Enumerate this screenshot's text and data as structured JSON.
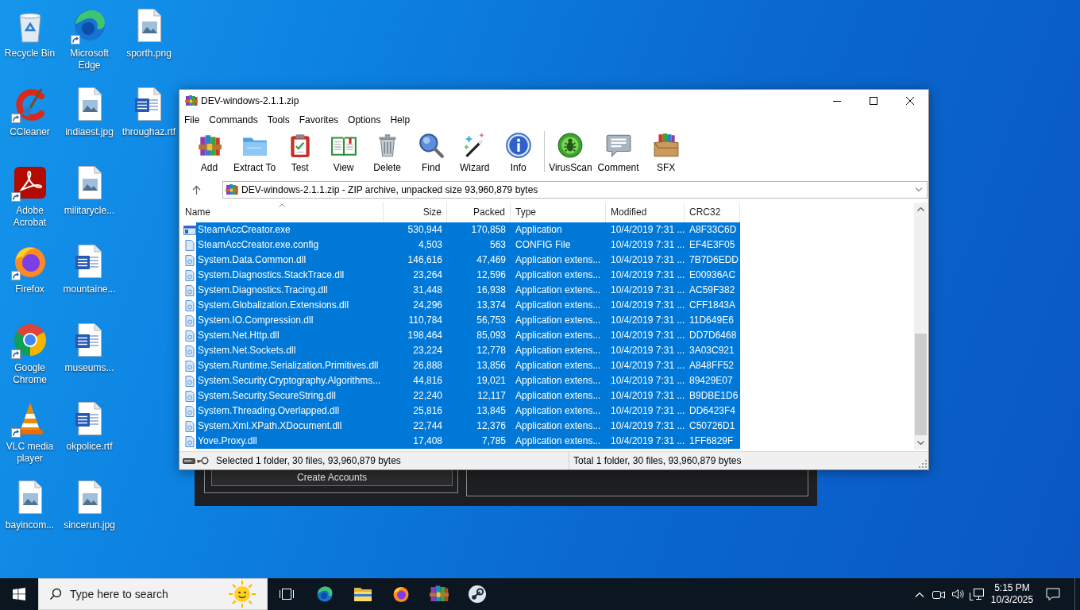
{
  "desktop": {
    "icons": [
      {
        "label": "Recycle Bin",
        "kind": "recycle-bin",
        "shortcut": false
      },
      {
        "label": "CCleaner",
        "kind": "ccleaner",
        "shortcut": true
      },
      {
        "label": "Adobe Acrobat",
        "kind": "acrobat",
        "shortcut": true
      },
      {
        "label": "Firefox",
        "kind": "firefox",
        "shortcut": true
      },
      {
        "label": "Google Chrome",
        "kind": "chrome",
        "shortcut": true
      },
      {
        "label": "VLC media player",
        "kind": "vlc",
        "shortcut": true
      },
      {
        "label": "bayincom...",
        "kind": "image",
        "shortcut": false
      },
      {
        "label": "Microsoft Edge",
        "kind": "edge",
        "shortcut": true
      },
      {
        "label": "indiaest.jpg",
        "kind": "image",
        "shortcut": false
      },
      {
        "label": "militarycle...",
        "kind": "image",
        "shortcut": false
      },
      {
        "label": "mountaine...",
        "kind": "word",
        "shortcut": false
      },
      {
        "label": "museums...",
        "kind": "word",
        "shortcut": false
      },
      {
        "label": "okpolice.rtf",
        "kind": "word",
        "shortcut": false
      },
      {
        "label": "sincerun.jpg",
        "kind": "image",
        "shortcut": false
      },
      {
        "label": "sporth.png",
        "kind": "image",
        "shortcut": false
      },
      {
        "label": "throughaz.rtf",
        "kind": "word",
        "shortcut": false
      }
    ]
  },
  "background_window": {
    "button": "Create Accounts"
  },
  "window": {
    "title": "DEV-windows-2.1.1.zip",
    "menu": [
      "File",
      "Commands",
      "Tools",
      "Favorites",
      "Options",
      "Help"
    ],
    "toolbar_groups": [
      {
        "buttons": [
          {
            "label": "Add",
            "kind": "add"
          },
          {
            "label": "Extract To",
            "kind": "extract"
          },
          {
            "label": "Test",
            "kind": "test"
          },
          {
            "label": "View",
            "kind": "view"
          },
          {
            "label": "Delete",
            "kind": "delete"
          },
          {
            "label": "Find",
            "kind": "find"
          },
          {
            "label": "Wizard",
            "kind": "wizard"
          },
          {
            "label": "Info",
            "kind": "info"
          }
        ]
      },
      {
        "buttons": [
          {
            "label": "VirusScan",
            "kind": "virusscan"
          },
          {
            "label": "Comment",
            "kind": "comment"
          },
          {
            "label": "SFX",
            "kind": "sfx"
          }
        ]
      }
    ],
    "address": "DEV-windows-2.1.1.zip - ZIP archive, unpacked size 93,960,879 bytes",
    "table": {
      "columns": [
        {
          "label": "Name",
          "sorted": true
        },
        {
          "label": "Size",
          "sorted": false
        },
        {
          "label": "Packed",
          "sorted": false
        },
        {
          "label": "Type",
          "sorted": false
        },
        {
          "label": "Modified",
          "sorted": false
        },
        {
          "label": "CRC32",
          "sorted": false
        }
      ],
      "rows": [
        {
          "kind": "exe",
          "name": "SteamAccCreator.exe",
          "size": "530,944",
          "packed": "170,858",
          "type": "Application",
          "modified": "10/4/2019 7:31 ...",
          "crc32": "A8F33C6D",
          "selected": true
        },
        {
          "kind": "config",
          "name": "SteamAccCreator.exe.config",
          "size": "4,503",
          "packed": "563",
          "type": "CONFIG File",
          "modified": "10/4/2019 7:31 ...",
          "crc32": "EF4E3F05",
          "selected": true
        },
        {
          "kind": "dll",
          "name": "System.Data.Common.dll",
          "size": "146,616",
          "packed": "47,469",
          "type": "Application extens...",
          "modified": "10/4/2019 7:31 ...",
          "crc32": "7B7D6EDD",
          "selected": true
        },
        {
          "kind": "dll",
          "name": "System.Diagnostics.StackTrace.dll",
          "size": "23,264",
          "packed": "12,596",
          "type": "Application extens...",
          "modified": "10/4/2019 7:31 ...",
          "crc32": "E00936AC",
          "selected": true
        },
        {
          "kind": "dll",
          "name": "System.Diagnostics.Tracing.dll",
          "size": "31,448",
          "packed": "16,938",
          "type": "Application extens...",
          "modified": "10/4/2019 7:31 ...",
          "crc32": "AC59F382",
          "selected": true
        },
        {
          "kind": "dll",
          "name": "System.Globalization.Extensions.dll",
          "size": "24,296",
          "packed": "13,374",
          "type": "Application extens...",
          "modified": "10/4/2019 7:31 ...",
          "crc32": "CFF1843A",
          "selected": true
        },
        {
          "kind": "dll",
          "name": "System.IO.Compression.dll",
          "size": "110,784",
          "packed": "56,753",
          "type": "Application extens...",
          "modified": "10/4/2019 7:31 ...",
          "crc32": "11D649E6",
          "selected": true
        },
        {
          "kind": "dll",
          "name": "System.Net.Http.dll",
          "size": "198,464",
          "packed": "85,093",
          "type": "Application extens...",
          "modified": "10/4/2019 7:31 ...",
          "crc32": "DD7D6468",
          "selected": true
        },
        {
          "kind": "dll",
          "name": "System.Net.Sockets.dll",
          "size": "23,224",
          "packed": "12,778",
          "type": "Application extens...",
          "modified": "10/4/2019 7:31 ...",
          "crc32": "3A03C921",
          "selected": true
        },
        {
          "kind": "dll",
          "name": "System.Runtime.Serialization.Primitives.dll",
          "size": "26,888",
          "packed": "13,856",
          "type": "Application extens...",
          "modified": "10/4/2019 7:31 ...",
          "crc32": "A848FF52",
          "selected": true
        },
        {
          "kind": "dll",
          "name": "System.Security.Cryptography.Algorithms...",
          "size": "44,816",
          "packed": "19,021",
          "type": "Application extens...",
          "modified": "10/4/2019 7:31 ...",
          "crc32": "89429E07",
          "selected": true
        },
        {
          "kind": "dll",
          "name": "System.Security.SecureString.dll",
          "size": "22,240",
          "packed": "12,117",
          "type": "Application extens...",
          "modified": "10/4/2019 7:31 ...",
          "crc32": "B9DBE1D6",
          "selected": true
        },
        {
          "kind": "dll",
          "name": "System.Threading.Overlapped.dll",
          "size": "25,816",
          "packed": "13,845",
          "type": "Application extens...",
          "modified": "10/4/2019 7:31 ...",
          "crc32": "DD6423F4",
          "selected": true
        },
        {
          "kind": "dll",
          "name": "System.Xml.XPath.XDocument.dll",
          "size": "22,744",
          "packed": "12,376",
          "type": "Application extens...",
          "modified": "10/4/2019 7:31 ...",
          "crc32": "C50726D1",
          "selected": true
        },
        {
          "kind": "dll",
          "name": "Yove.Proxy.dll",
          "size": "17,408",
          "packed": "7,785",
          "type": "Application extens...",
          "modified": "10/4/2019 7:31 ...",
          "crc32": "1FF6829F",
          "selected": true
        }
      ]
    },
    "status_bar": {
      "left": "Selected 1 folder, 30 files, 93,960,879 bytes",
      "right": "Total 1 folder, 30 files, 93,960,879 bytes"
    }
  },
  "taskbar": {
    "search": {
      "placeholder": "Type here to search"
    },
    "clock": {
      "time": "5:15 PM",
      "date": "10/3/2025"
    }
  }
}
